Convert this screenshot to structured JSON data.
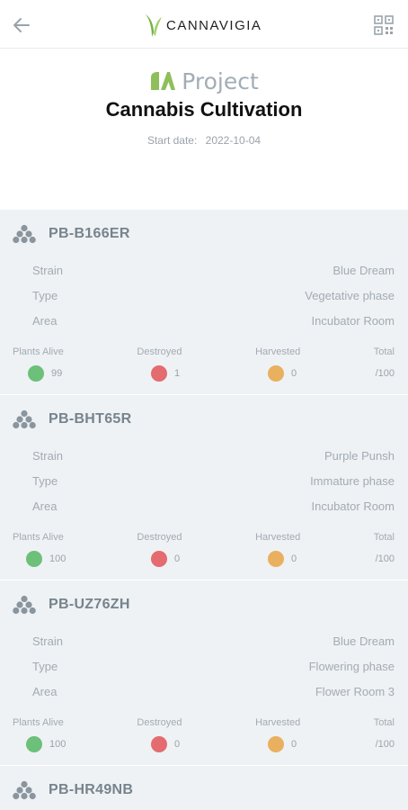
{
  "header": {
    "logo_text": "CANNAVIGIA"
  },
  "project": {
    "label": "Project",
    "name": "Cannabis Cultivation",
    "start_label": "Start date:",
    "start_date": "2022-10-04"
  },
  "labels": {
    "strain": "Strain",
    "type": "Type",
    "area": "Area",
    "plants_alive": "Plants Alive",
    "destroyed": "Destroyed",
    "harvested": "Harvested",
    "total": "Total"
  },
  "colors": {
    "alive": "#6cc07a",
    "destroyed": "#e46b6f",
    "harvested": "#e9b060",
    "accent": "#8fbf5a"
  },
  "batches": [
    {
      "id": "PB-B166ER",
      "strain": "Blue Dream",
      "type": "Vegetative phase",
      "area": "Incubator Room",
      "alive": "99",
      "destroyed": "1",
      "harvested": "0",
      "total": "/100"
    },
    {
      "id": "PB-BHT65R",
      "strain": "Purple Punsh",
      "type": "Immature phase",
      "area": "Incubator Room",
      "alive": "100",
      "destroyed": "0",
      "harvested": "0",
      "total": "/100"
    },
    {
      "id": "PB-UZ76ZH",
      "strain": "Blue Dream",
      "type": "Flowering phase",
      "area": "Flower Room 3",
      "alive": "100",
      "destroyed": "0",
      "harvested": "0",
      "total": "/100"
    },
    {
      "id": "PB-HR49NB"
    }
  ]
}
